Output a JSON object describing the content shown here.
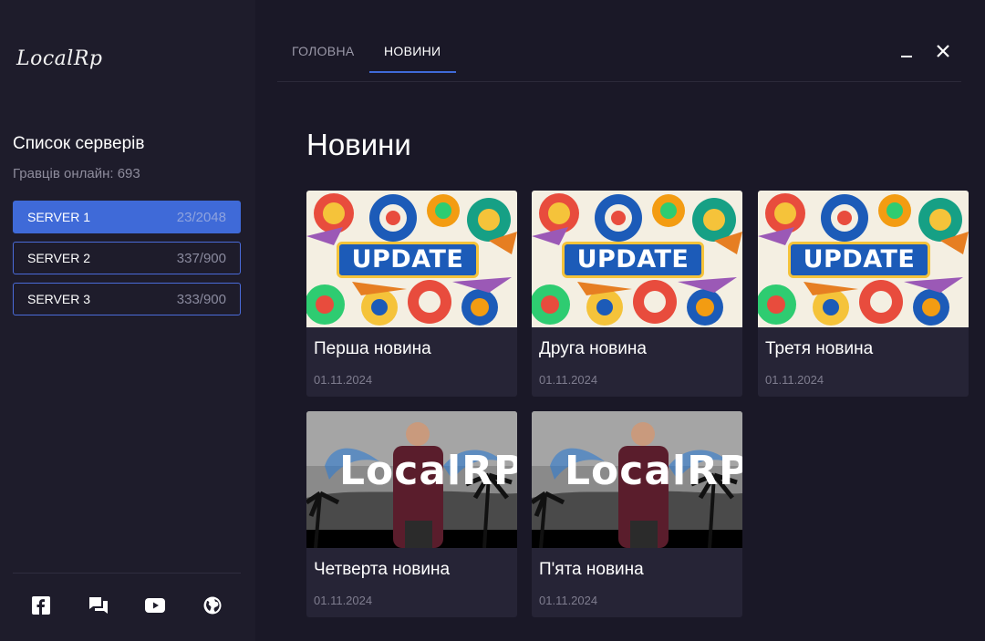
{
  "app": {
    "logo_text": "LocalRp"
  },
  "sidebar": {
    "title": "Список серверів",
    "online": "Гравців онлайн: 693",
    "servers": [
      {
        "name": "SERVER 1",
        "count": "23/2048",
        "active": true
      },
      {
        "name": "SERVER 2",
        "count": "337/900",
        "active": false
      },
      {
        "name": "SERVER 3",
        "count": "333/900",
        "active": false
      }
    ],
    "social_icons": [
      "facebook-icon",
      "forum-icon",
      "youtube-icon",
      "globe-icon"
    ]
  },
  "nav": {
    "tabs": [
      {
        "label": "ГОЛОВНА",
        "active": false
      },
      {
        "label": "НОВИНИ",
        "active": true
      }
    ],
    "minimize_icon": "minimize-icon",
    "close_icon": "close-icon"
  },
  "main": {
    "title": "Новини",
    "news": [
      {
        "title": "Перша новина",
        "date": "01.11.2024",
        "image": "update-banner",
        "image_text": "UPDATE"
      },
      {
        "title": "Друга новина",
        "date": "01.11.2024",
        "image": "update-banner",
        "image_text": "UPDATE"
      },
      {
        "title": "Третя новина",
        "date": "01.11.2024",
        "image": "update-banner",
        "image_text": "UPDATE"
      },
      {
        "title": "Четверта новина",
        "date": "01.11.2024",
        "image": "localrp-banner",
        "image_text": "LocalRP"
      },
      {
        "title": "П'ята новина",
        "date": "01.11.2024",
        "image": "localrp-banner",
        "image_text": "LocalRP"
      }
    ]
  },
  "colors": {
    "background": "#1a1827",
    "sidebar": "#1e1c2b",
    "accent": "#3f6ad8",
    "card": "#262436",
    "muted": "#7f7d8f"
  }
}
